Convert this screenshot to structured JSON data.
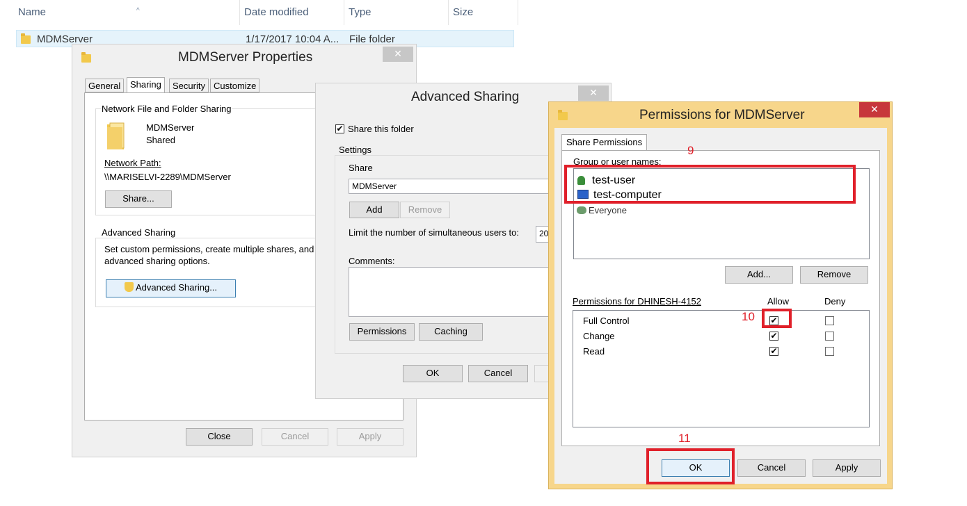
{
  "explorer": {
    "columns": [
      "Name",
      "Date modified",
      "Type",
      "Size"
    ],
    "row": {
      "name": "MDMServer",
      "date": "1/17/2017 10:04 A...",
      "type": "File folder"
    }
  },
  "properties": {
    "title": "MDMServer Properties",
    "close": "✕",
    "tabs": [
      "General",
      "Sharing",
      "Security",
      "Customize"
    ],
    "nfs_group": "Network File and Folder Sharing",
    "folder_name": "MDMServer",
    "folder_status": "Shared",
    "network_path_label": "Network Path:",
    "network_path": "\\\\MARISELVI-2289\\MDMServer",
    "share_button": "Share...",
    "adv_group": "Advanced Sharing",
    "adv_text_1": "Set custom permissions, create multiple shares, and",
    "adv_text_2": "advanced sharing options.",
    "adv_button": "Advanced Sharing...",
    "close_btn": "Close",
    "cancel_btn": "Cancel",
    "apply_btn": "Apply"
  },
  "advanced": {
    "title": "Advanced Sharing",
    "close": "✕",
    "share_folder": "Share this folder",
    "settings_group": "Settings",
    "share_label": "Share",
    "share_value": "MDMServer",
    "add_btn": "Add",
    "remove_btn": "Remove",
    "limit_label": "Limit the number of simultaneous users to:",
    "limit_value": "20",
    "comments_label": "Comments:",
    "permissions_btn": "Permissions",
    "caching_btn": "Caching",
    "ok_btn": "OK",
    "cancel_btn": "Cancel"
  },
  "permissions": {
    "title": "Permissions for MDMServer",
    "close": "✕",
    "tab": "Share Permissions",
    "group_label": "Group or user names:",
    "users": [
      "test-user",
      "test-computer",
      "Everyone"
    ],
    "add_btn": "Add...",
    "remove_btn": "Remove",
    "perm_label": "Permissions for DHINESH-4152",
    "allow": "Allow",
    "deny": "Deny",
    "rows": [
      {
        "name": "Full Control",
        "allow": true,
        "deny": false
      },
      {
        "name": "Change",
        "allow": true,
        "deny": false
      },
      {
        "name": "Read",
        "allow": true,
        "deny": false
      }
    ],
    "ok_btn": "OK",
    "cancel_btn": "Cancel",
    "apply_btn": "Apply"
  },
  "annotations": {
    "n9": "9",
    "n10": "10",
    "n11": "11"
  },
  "check_glyph": "✔"
}
